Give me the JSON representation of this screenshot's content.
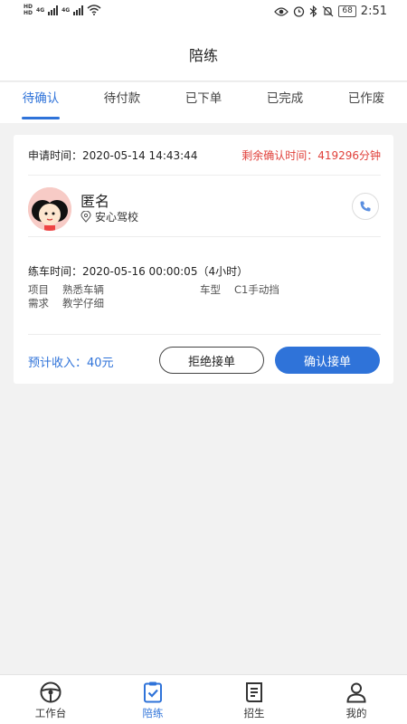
{
  "status_bar": {
    "left_labels": [
      "HD",
      "HD",
      "4G",
      "4G"
    ],
    "battery": "68",
    "time": "2:51"
  },
  "navbar": {
    "title": "陪练"
  },
  "tabs": [
    {
      "label": "待确认",
      "active": true
    },
    {
      "label": "待付款",
      "active": false
    },
    {
      "label": "已下单",
      "active": false
    },
    {
      "label": "已完成",
      "active": false
    },
    {
      "label": "已作废",
      "active": false
    }
  ],
  "order": {
    "apply_time": "申请时间：2020-05-14 14:43:44",
    "remaining": "剩余确认时间：419296分钟",
    "name": "匿名",
    "school": "安心驾校",
    "train_time": "练车时间：2020-05-16 00:00:05（4小时）",
    "project_label": "项目",
    "project_value": "熟悉车辆",
    "car_label": "车型",
    "car_value": "C1手动挡",
    "need_label": "需求",
    "need_value": "教学仔细",
    "income": "预计收入：40元",
    "reject_label": "拒绝接单",
    "confirm_label": "确认接单"
  },
  "colors": {
    "accent": "#2f73d9",
    "warning": "#e0403a"
  },
  "bottom_nav": [
    {
      "label": "工作台",
      "icon": "steering-wheel-icon",
      "active": false
    },
    {
      "label": "陪练",
      "icon": "clipboard-check-icon",
      "active": true
    },
    {
      "label": "招生",
      "icon": "document-list-icon",
      "active": false
    },
    {
      "label": "我的",
      "icon": "user-icon",
      "active": false
    }
  ]
}
